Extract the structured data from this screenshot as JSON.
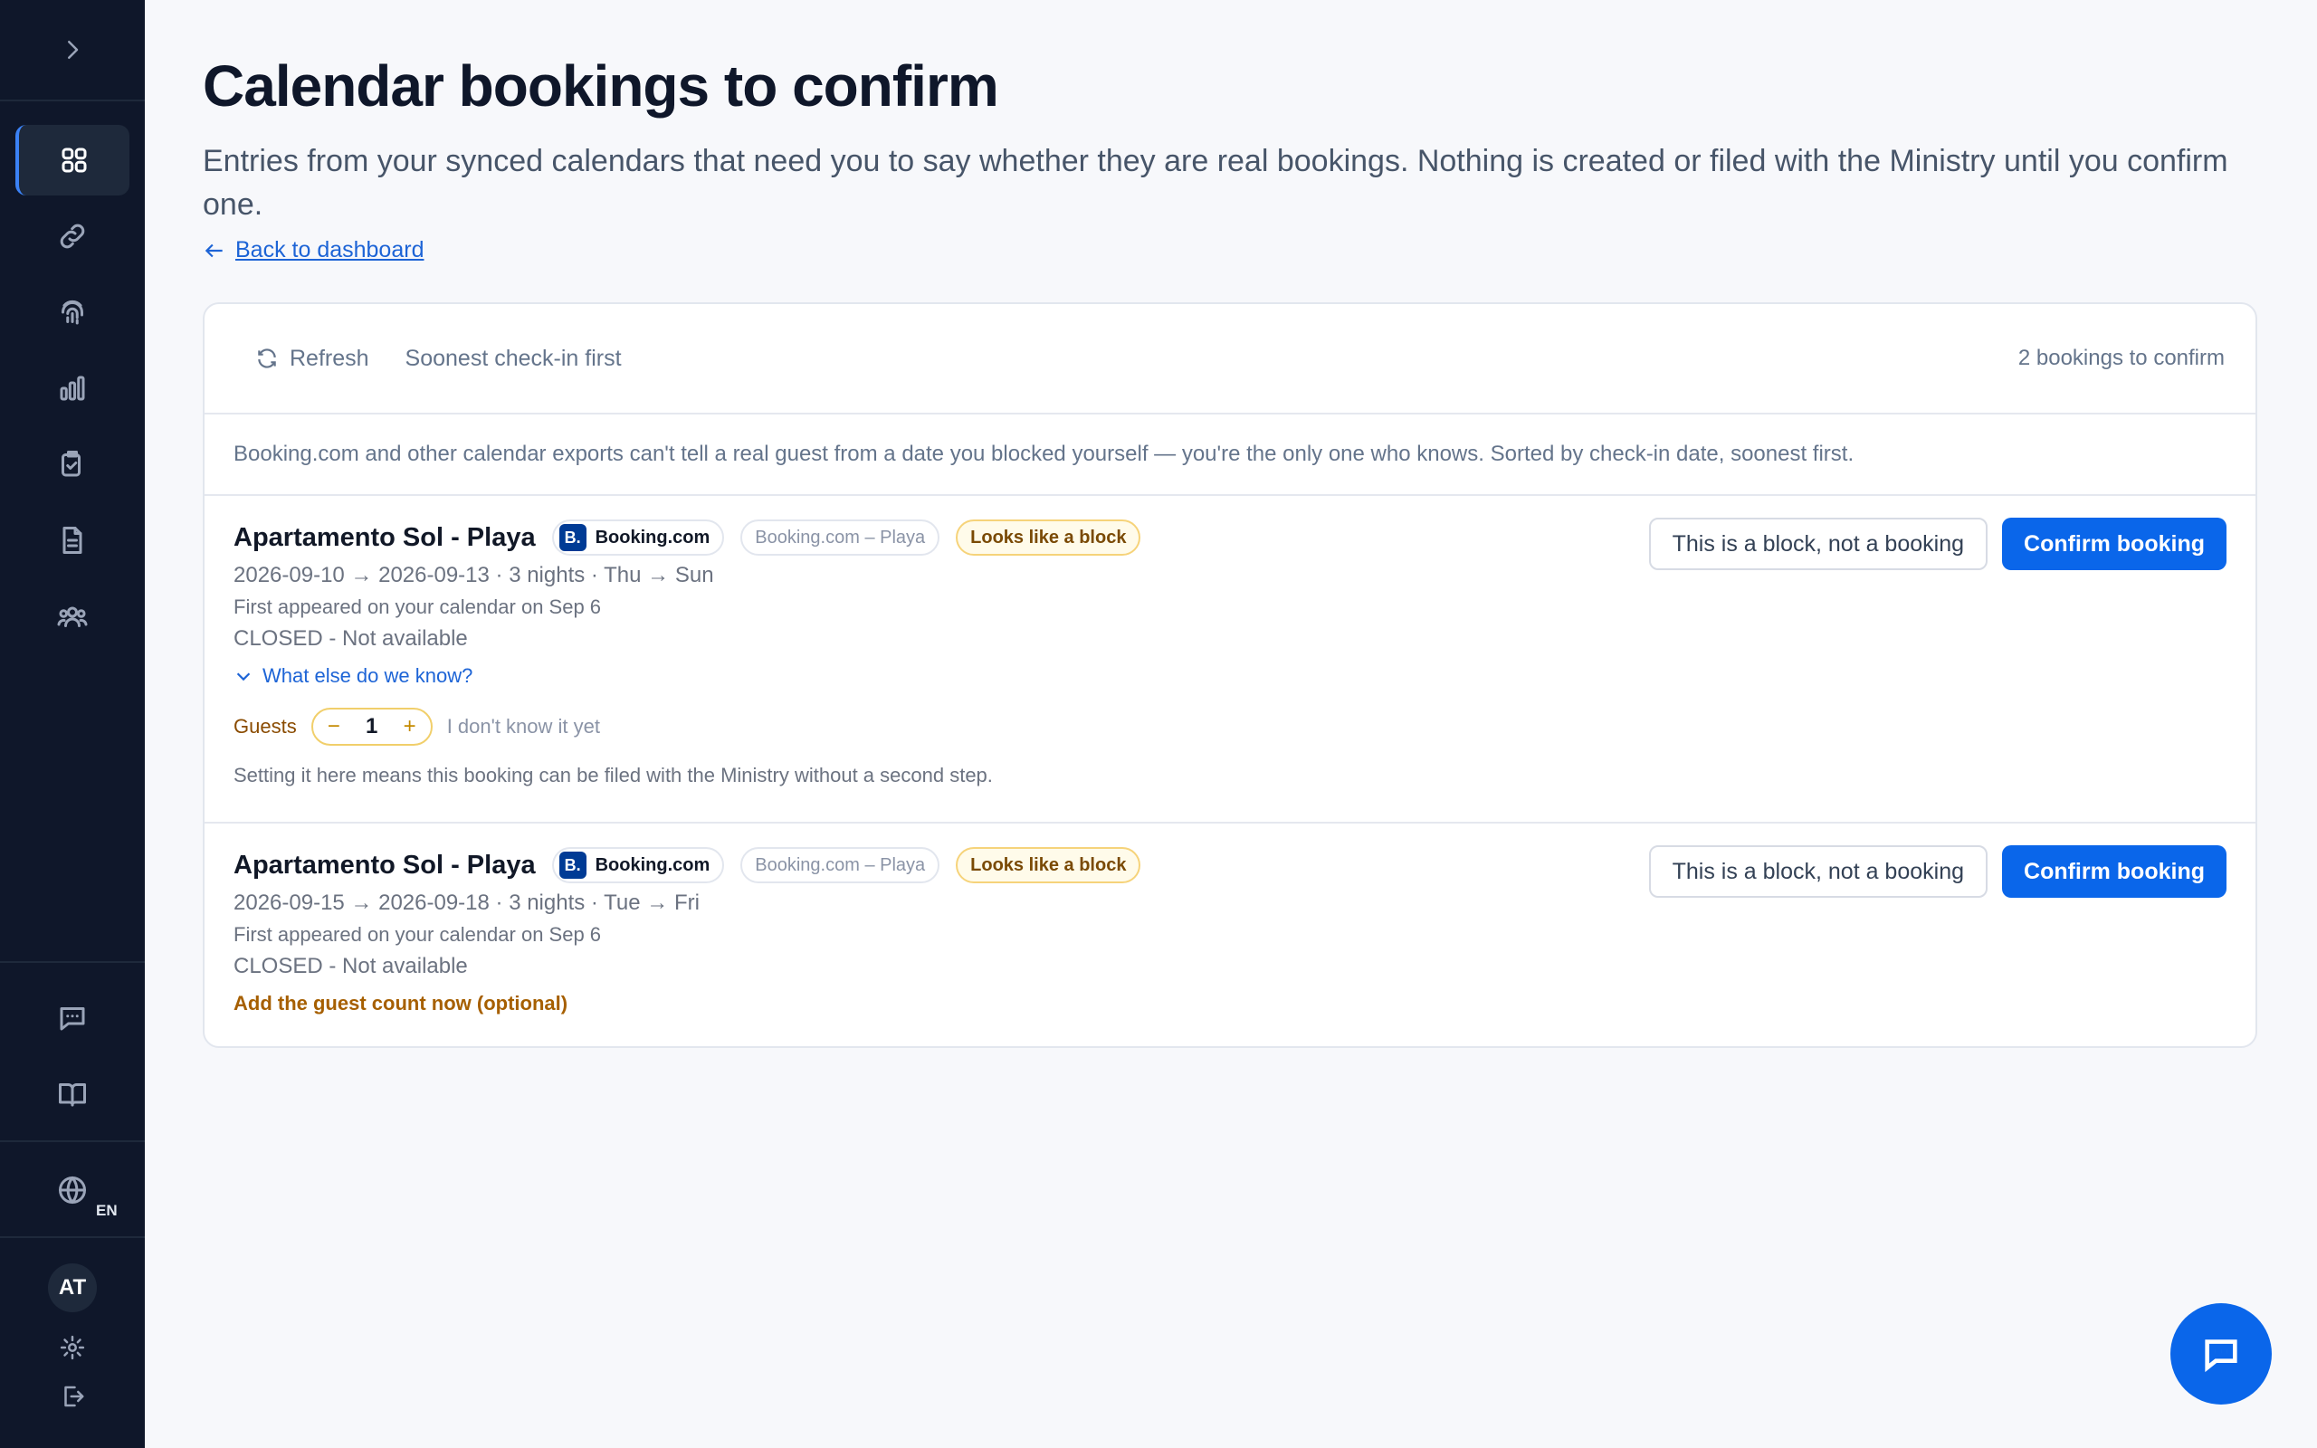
{
  "sidebar": {
    "expand_icon": "chevron-right-icon",
    "nav": [
      {
        "name": "dashboard",
        "icon": "grid-icon",
        "active": true
      },
      {
        "name": "connections",
        "icon": "link-icon",
        "active": false
      },
      {
        "name": "identity",
        "icon": "fingerprint-icon",
        "active": false
      },
      {
        "name": "reports",
        "icon": "bar-chart-icon",
        "active": false
      },
      {
        "name": "tasks",
        "icon": "clipboard-check-icon",
        "active": false
      },
      {
        "name": "documents",
        "icon": "document-icon",
        "active": false
      },
      {
        "name": "guests",
        "icon": "users-icon",
        "active": false
      }
    ],
    "help": [
      "chat-icon",
      "book-icon"
    ],
    "language": "EN",
    "user_initials": "AT"
  },
  "page": {
    "title": "Calendar bookings to confirm",
    "subtitle": "Entries from your synced calendars that need you to say whether they are real bookings. Nothing is created or filed with the Ministry until you confirm one.",
    "back_link": "Back to dashboard"
  },
  "toolbar": {
    "refresh": "Refresh",
    "sort": "Soonest check-in first",
    "count": "2 bookings to confirm"
  },
  "info": "Booking.com and other calendar exports can't tell a real guest from a date you blocked yourself — you're the only one who knows. Sorted by check-in date, soonest first.",
  "bookings": [
    {
      "property": "Apartamento Sol - Playa",
      "channel": "Booking.com",
      "channel_logo": "B.",
      "calendar": "Booking.com – Playa",
      "warning": "Looks like a block",
      "dates": "2026-09-10 → 2026-09-13 · 3 nights · Thu → Sun",
      "appeared": "First appeared on your calendar on Sep 6",
      "status": "CLOSED - Not available",
      "know_more": "What else do we know?",
      "guests_label": "Guests",
      "guests_value": "1",
      "guests_unknown": "I don't know it yet",
      "hint": "Setting it here means this booking can be filed with the Ministry without a second step.",
      "block_button": "This is a block, not a booking",
      "confirm_button": "Confirm booking"
    },
    {
      "property": "Apartamento Sol - Playa",
      "channel": "Booking.com",
      "channel_logo": "B.",
      "calendar": "Booking.com – Playa",
      "warning": "Looks like a block",
      "dates": "2026-09-15 → 2026-09-18 · 3 nights · Tue → Fri",
      "appeared": "First appeared on your calendar on Sep 6",
      "status": "CLOSED - Not available",
      "add_guest": "Add the guest count now (optional)",
      "block_button": "This is a block, not a booking",
      "confirm_button": "Confirm booking"
    }
  ],
  "colors": {
    "sidebar_bg": "#0f172a",
    "primary": "#0a66ea",
    "warning_border": "#f6d37a"
  }
}
